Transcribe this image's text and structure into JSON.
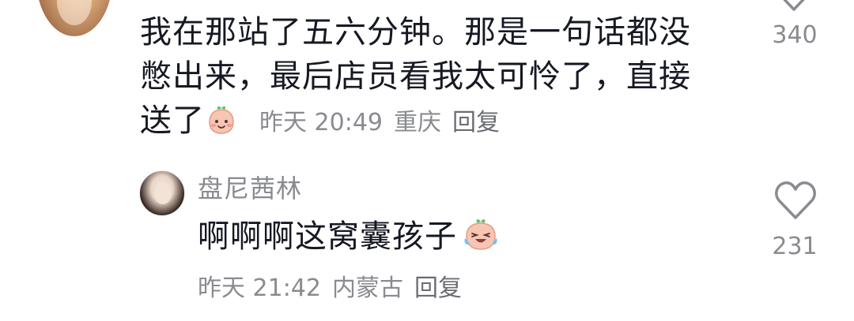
{
  "comment": {
    "text_line1": "我在那站了五六分钟。那是一句话都没",
    "text_line2": "憋出来，最后店员看我太可怜了，直接",
    "text_line3": "送了",
    "emoji": "smile-emoji",
    "time": "昨天 20:49",
    "location": "重庆",
    "reply_label": "回复",
    "likes": "340"
  },
  "reply": {
    "username": "盘尼茜林",
    "text": "啊啊啊这窝囊孩子",
    "emoji": "laugh-cry-emoji",
    "time": "昨天 21:42",
    "location": "内蒙古",
    "reply_label": "回复",
    "likes": "231"
  },
  "colors": {
    "text": "#161823",
    "meta": "#8a8b91",
    "emoji_face": "#f7c6b2",
    "emoji_leaf": "#5cc26a"
  }
}
